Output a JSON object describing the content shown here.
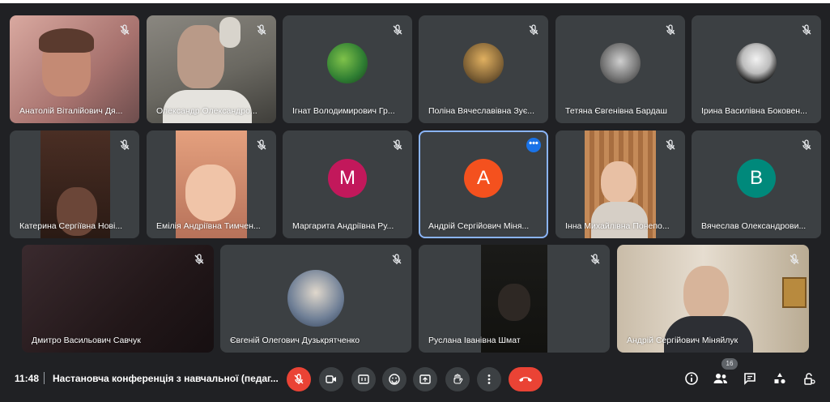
{
  "participants": [
    {
      "name": "Анатолій Віталійович Дя...",
      "type": "video",
      "bg": "#b98c8a"
    },
    {
      "name": "Олександр Олександро...",
      "type": "video",
      "bg": "#7c7a73"
    },
    {
      "name": "Ігнат Володимирович Гр...",
      "type": "photo",
      "bg": "#3c4043"
    },
    {
      "name": "Поліна Вячеславівна Зує...",
      "type": "photo",
      "bg": "#3c4043"
    },
    {
      "name": "Тетяна Євгенівна Бардаш",
      "type": "photo",
      "bg": "#3c4043"
    },
    {
      "name": "Ірина Василівна Боковен...",
      "type": "photo",
      "bg": "#3c4043"
    },
    {
      "name": "Катерина Сергіївна Нові...",
      "type": "video",
      "bg": "#3a2a24"
    },
    {
      "name": "Емілія Андріївна Тимчен...",
      "type": "video",
      "bg": "#c98e78"
    },
    {
      "name": "Маргарита Андріївна Ру...",
      "type": "letter",
      "letter": "M",
      "color": "#c2185b"
    },
    {
      "name": "Андрій Сергійович Міня...",
      "type": "letter",
      "letter": "A",
      "color": "#f4511e"
    },
    {
      "name": "Інна Михайлівна Понепо...",
      "type": "video",
      "bg": "#b4825a"
    },
    {
      "name": "Вячеслав Олександрови...",
      "type": "letter",
      "letter": "B",
      "color": "#00897b"
    },
    {
      "name": "Дмитро Васильович Савчук",
      "type": "video",
      "bg": "#2b2022"
    },
    {
      "name": "Євгеній Олегович Дузькрятченко",
      "type": "photo",
      "bg": "#3c4043"
    },
    {
      "name": "Руслана Іванівна Шмат",
      "type": "video",
      "bg": "#1c1c1a"
    },
    {
      "name": "Андрій Сергійович Міняйлук",
      "type": "video",
      "bg": "#d8cfc3"
    }
  ],
  "bottom": {
    "time": "11:48",
    "meeting_title": "Настановча конференція з навчальної (педаг...",
    "participant_count": "16"
  },
  "colors": {
    "background": "#202124",
    "tile": "#3c4043",
    "danger": "#ea4335",
    "accent": "#8ab4f8"
  },
  "icons": {
    "mic": "mic-off-icon",
    "camera": "camera-icon",
    "captions": "captions-icon",
    "emoji": "emoji-icon",
    "present": "present-screen-icon",
    "hand": "raise-hand-icon",
    "more": "more-options-icon",
    "leave": "leave-call-icon",
    "info": "info-icon",
    "people": "people-icon",
    "chat": "chat-icon",
    "activities": "activities-icon",
    "host": "host-controls-icon"
  }
}
